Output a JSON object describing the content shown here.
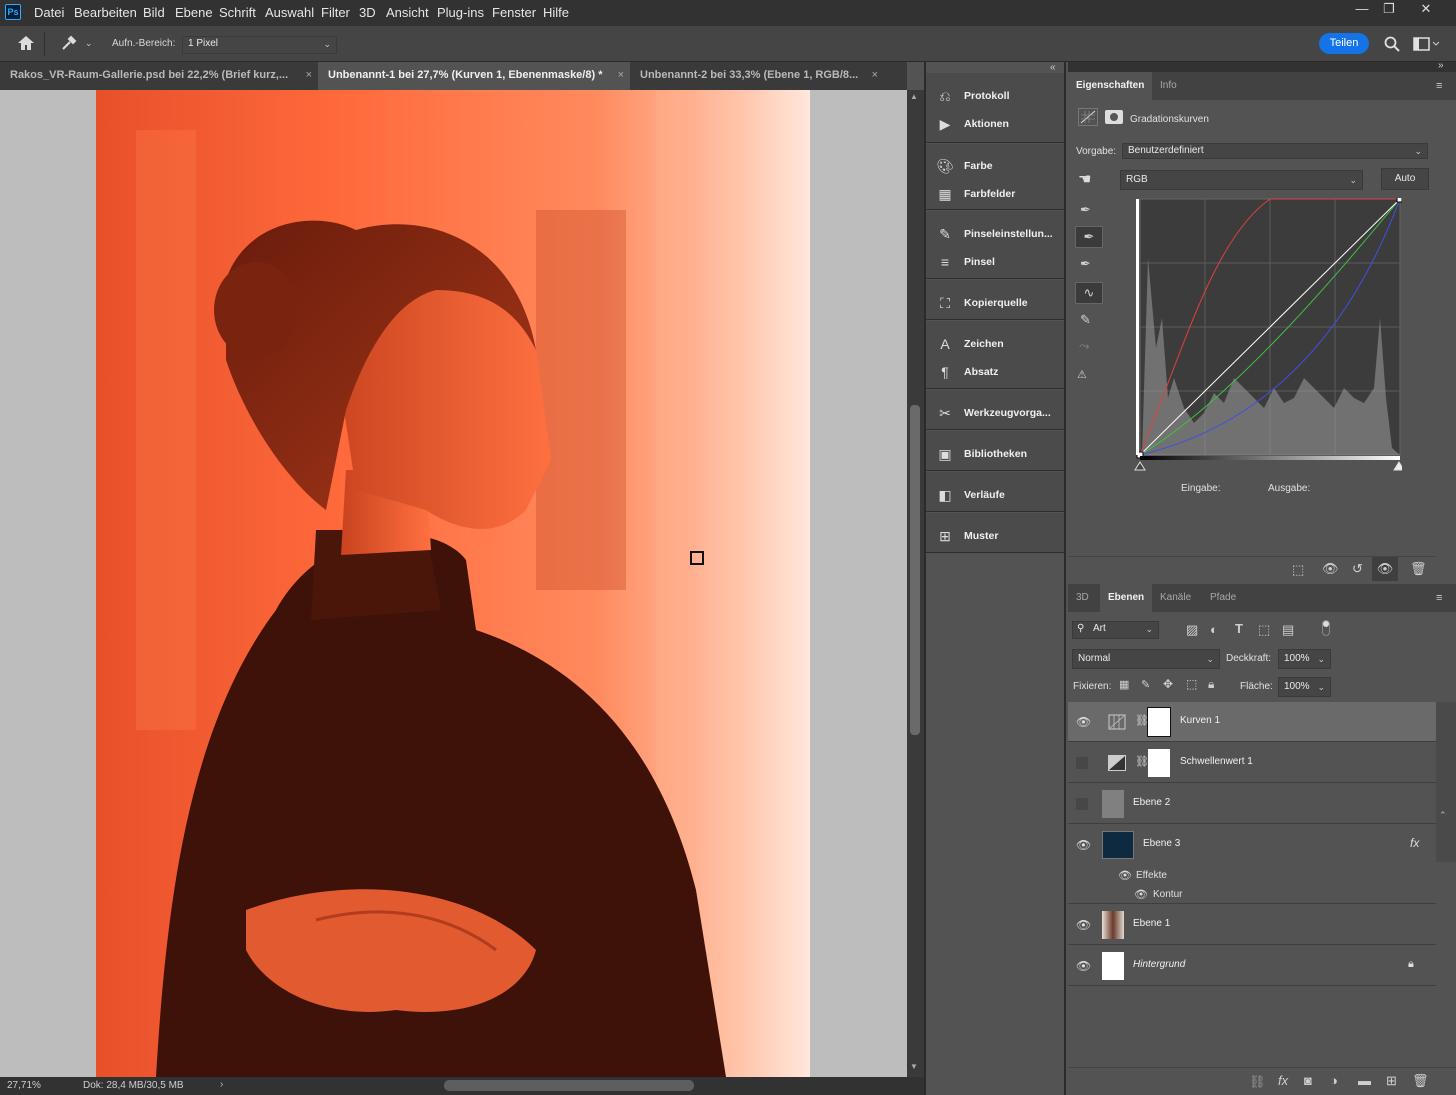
{
  "app": {
    "logo": "Ps"
  },
  "menu": [
    "Datei",
    "Bearbeiten",
    "Bild",
    "Ebene",
    "Schrift",
    "Auswahl",
    "Filter",
    "3D",
    "Ansicht",
    "Plug-ins",
    "Fenster",
    "Hilfe"
  ],
  "window_controls": {
    "minimize": "—",
    "restore": "❐",
    "close": "✕"
  },
  "options": {
    "sample_label": "Aufn.-Bereich:",
    "sample_value": "1 Pixel",
    "share": "Teilen"
  },
  "tabs": [
    {
      "label": "Rakos_VR-Raum-Gallerie.psd bei 22,2% (Brief kurz,...",
      "close": "×"
    },
    {
      "label": "Unbenannt-1 bei 27,7% (Kurven 1, Ebenenmaske/8) *",
      "close": "×"
    },
    {
      "label": "Unbenannt-2 bei 33,3% (Ebene 1, RGB/8...",
      "close": "×"
    }
  ],
  "status": {
    "zoom": "27,71%",
    "doc": "Dok: 28,4 MB/30,5 MB",
    "arrow": "›"
  },
  "dock": {
    "protokoll": "Protokoll",
    "aktionen": "Aktionen",
    "farbe": "Farbe",
    "farbfelder": "Farbfelder",
    "pinseleinstellungen": "Pinseleinstellun...",
    "pinsel": "Pinsel",
    "kopierquelle": "Kopierquelle",
    "zeichen": "Zeichen",
    "absatz": "Absatz",
    "werkzeugvorgaben": "Werkzeugvorga...",
    "bibliotheken": "Bibliotheken",
    "verlaeufe": "Verläufe",
    "muster": "Muster"
  },
  "properties": {
    "tab_active": "Eigenschaften",
    "tab_info": "Info",
    "title": "Gradationskurven",
    "preset_label": "Vorgabe:",
    "preset_value": "Benutzerdefiniert",
    "channel": "RGB",
    "auto": "Auto",
    "input_label": "Eingabe:",
    "output_label": "Ausgabe:"
  },
  "layers_panel": {
    "tabs": [
      "3D",
      "Ebenen",
      "Kanäle",
      "Pfade"
    ],
    "filter": "Art",
    "blend_mode": "Normal",
    "opacity_label": "Deckkraft:",
    "opacity": "100%",
    "lock_label": "Fixieren:",
    "fill_label": "Fläche:",
    "fill": "100%",
    "fx": "fx",
    "layers": [
      {
        "name": "Kurven 1",
        "visible": true,
        "selected": true
      },
      {
        "name": "Schwellenwert 1",
        "visible": false
      },
      {
        "name": "Ebene 2",
        "visible": false
      },
      {
        "name": "Ebene 3",
        "visible": true,
        "effects_label": "Effekte",
        "effect": "Kontur"
      },
      {
        "name": "Ebene 1",
        "visible": true
      },
      {
        "name": "Hintergrund",
        "visible": true,
        "locked": true
      }
    ]
  },
  "colors": {
    "accent": "#1473e6",
    "ps_blue": "#31a8ff",
    "photo_tint": "#ff5a2a",
    "ebene3_thumb": "#0d2a40"
  }
}
